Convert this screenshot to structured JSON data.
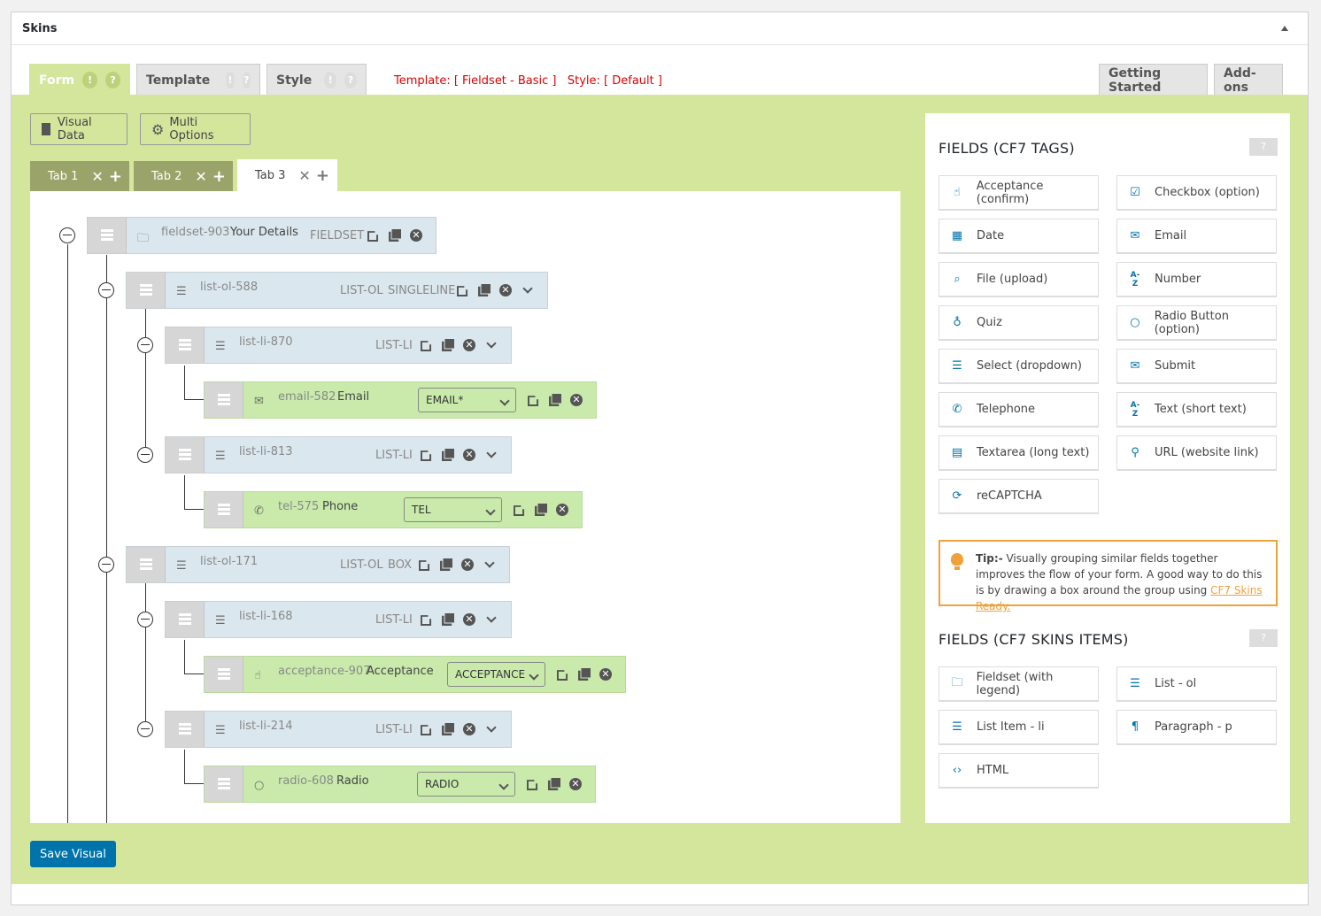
{
  "panel": {
    "title": "Skins"
  },
  "nav": {
    "tabs": [
      {
        "label": "Form",
        "badges": [
          "!",
          "?"
        ]
      },
      {
        "label": "Template",
        "badges": [
          "!",
          "?"
        ]
      },
      {
        "label": "Style",
        "badges": [
          "!",
          "?"
        ]
      }
    ],
    "template_info": "Template: [ Fieldset - Basic ]   Style: [ Default ]",
    "right_tabs": [
      "Getting Started",
      "Add-ons"
    ]
  },
  "toolbar": {
    "visual_data": "Visual Data",
    "multi_options": "Multi Options"
  },
  "form_tabs": [
    {
      "label": "Tab 1"
    },
    {
      "label": "Tab 2"
    },
    {
      "label": "Tab 3"
    }
  ],
  "tree": {
    "fieldset": {
      "id": "fieldset-903",
      "label": "Your Details",
      "type": "FIELDSET"
    },
    "ol1": {
      "id": "list-ol-588",
      "type": "LIST-OL",
      "subtype": "SINGLELINE"
    },
    "li1": {
      "id": "list-li-870",
      "type": "LIST-LI"
    },
    "email": {
      "id": "email-582",
      "label": "Email",
      "select": "EMAIL*"
    },
    "li2": {
      "id": "list-li-813",
      "type": "LIST-LI"
    },
    "tel": {
      "id": "tel-575",
      "label": "Phone",
      "select": "TEL"
    },
    "ol2": {
      "id": "list-ol-171",
      "type": "LIST-OL",
      "subtype": "BOX"
    },
    "li3": {
      "id": "list-li-168",
      "type": "LIST-LI"
    },
    "acc": {
      "id": "acceptance-907",
      "label": "Acceptance",
      "select": "ACCEPTANCE"
    },
    "li4": {
      "id": "list-li-214",
      "type": "LIST-LI"
    },
    "radio": {
      "id": "radio-608",
      "label": "Radio",
      "select": "RADIO"
    }
  },
  "sidebar": {
    "cf7_heading": "FIELDS (CF7 TAGS)",
    "help": "?",
    "cf7_fields": [
      "Acceptance (confirm)",
      "Checkbox (option)",
      "Date",
      "Email",
      "File (upload)",
      "Number",
      "Quiz",
      "Radio Button (option)",
      "Select (dropdown)",
      "Submit",
      "Telephone",
      "Text (short text)",
      "Textarea (long text)",
      "URL (website link)",
      "reCAPTCHA"
    ],
    "tip_label": "Tip:-",
    "tip_text": " Visually grouping similar fields together improves the flow of your form. A good way to do this is by drawing a box around the group using ",
    "tip_link": "CF7 Skins Ready.",
    "skins_heading": "FIELDS (CF7 SKINS ITEMS)",
    "skins_fields": [
      "Fieldset (with legend)",
      "List - ol",
      "List Item - li",
      "Paragraph - p",
      "HTML"
    ]
  },
  "save_button": "Save Visual",
  "colors": {
    "green_bg": "#d4e59c",
    "blue_node": "#dbe7ee",
    "green_node": "#c9eaab",
    "save": "#0073aa",
    "tip": "#f0a13a",
    "template_red": "#dd0000"
  }
}
